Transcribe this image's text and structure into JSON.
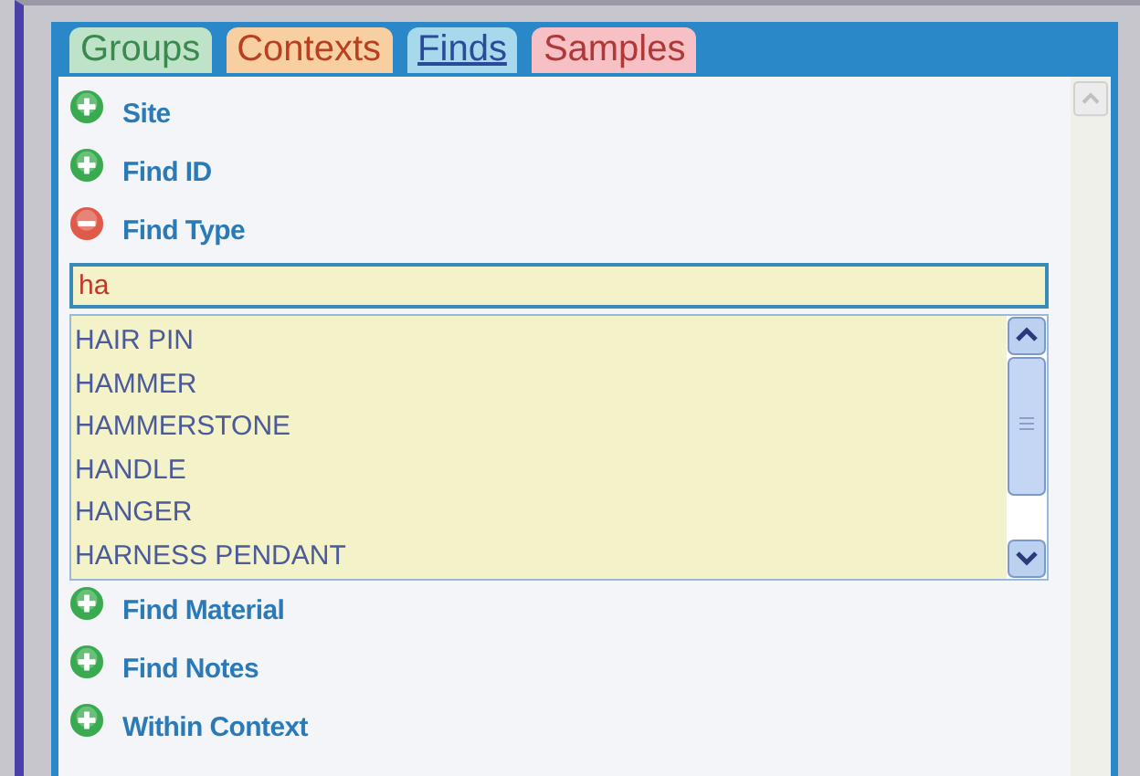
{
  "tabs": [
    {
      "label": "Groups",
      "selected": false,
      "color": "#bfe3c8"
    },
    {
      "label": "Contexts",
      "selected": false,
      "color": "#f8cfa0"
    },
    {
      "label": "Finds",
      "selected": true,
      "color": "#a8d8ec"
    },
    {
      "label": "Samples",
      "selected": false,
      "color": "#f6c0c4"
    }
  ],
  "filters": [
    {
      "label": "Site",
      "expanded": false
    },
    {
      "label": "Find ID",
      "expanded": false
    },
    {
      "label": "Find Type",
      "expanded": true,
      "value": "ha",
      "options": [
        "HAIR PIN",
        "HAMMER",
        "HAMMERSTONE",
        "HANDLE",
        "HANGER",
        "HARNESS PENDANT"
      ]
    },
    {
      "label": "Find Material",
      "expanded": false
    },
    {
      "label": "Find Notes",
      "expanded": false
    },
    {
      "label": "Within Context",
      "expanded": false
    }
  ]
}
